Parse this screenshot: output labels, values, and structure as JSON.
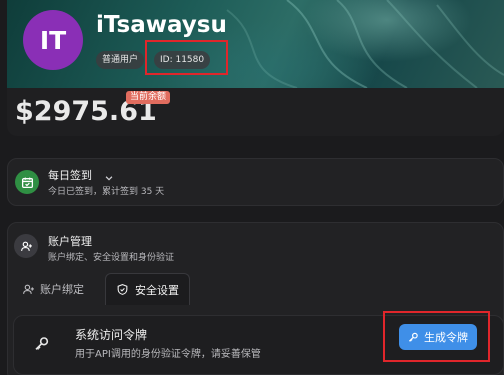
{
  "profile": {
    "avatar_initials": "IT",
    "username": "iTsawaysu",
    "role_badge": "普通用户",
    "id_badge": "ID: 11580",
    "avatar_color": "#8a2fb6"
  },
  "balance": {
    "amount": "$2975.61",
    "tag": "当前余额"
  },
  "checkin": {
    "title": "每日签到",
    "subtitle": "今日已签到，累计签到 35 天",
    "icon": "calendar-check-icon"
  },
  "account": {
    "title": "账户管理",
    "subtitle": "账户绑定、安全设置和身份验证",
    "icon": "user-plus-icon"
  },
  "tabs": [
    {
      "label": "账户绑定",
      "icon": "user-plus-icon",
      "active": false
    },
    {
      "label": "安全设置",
      "icon": "shield-icon",
      "active": true
    }
  ],
  "token": {
    "title": "系统访问令牌",
    "subtitle": "用于API调用的身份验证令牌，请妥善保管",
    "button_label": "生成令牌",
    "icon": "key-icon",
    "button_icon": "key-icon"
  },
  "colors": {
    "accent": "#3f8fe8",
    "highlight": "#e0262b",
    "checkin_icon_bg": "#2f8f43",
    "balance_tag": "#e06c5e"
  }
}
